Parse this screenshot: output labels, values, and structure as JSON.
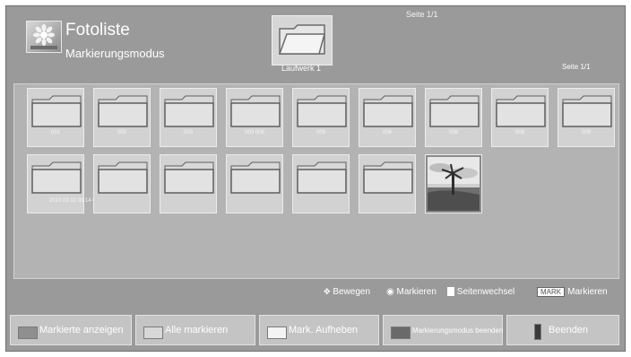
{
  "header": {
    "title": "Fotoliste",
    "subtitle": "Markierungsmodus",
    "page_indicator_top": "Seite 1/1",
    "drive_label": "Laufwerk 1",
    "page_indicator_right": "Seite 1/1"
  },
  "tiles": [
    {
      "type": "folder",
      "label": "001"
    },
    {
      "type": "folder",
      "label": "002"
    },
    {
      "type": "folder",
      "label": "003"
    },
    {
      "type": "folder",
      "label": "003 006"
    },
    {
      "type": "folder",
      "label": "005"
    },
    {
      "type": "folder",
      "label": "006"
    },
    {
      "type": "folder",
      "label": "008"
    },
    {
      "type": "folder",
      "label": "008"
    },
    {
      "type": "folder",
      "label": "009"
    },
    {
      "type": "folder",
      "label": "2010 03 02 03 14 01 1"
    },
    {
      "type": "folder",
      "label": ""
    },
    {
      "type": "folder",
      "label": ""
    },
    {
      "type": "folder",
      "label": ""
    },
    {
      "type": "folder",
      "label": ""
    },
    {
      "type": "folder",
      "label": ""
    },
    {
      "type": "photo",
      "label": ""
    }
  ],
  "status": {
    "move": "Bewegen",
    "mark": "Markieren",
    "page_change": "Seitenwechsel",
    "mark_key": "MARK",
    "mark_key_label": "Markieren"
  },
  "buttons": [
    {
      "label": "Markierte anzeigen",
      "color": "#8f8f8f"
    },
    {
      "label": "Alle markieren",
      "color": "#d8d8d8"
    },
    {
      "label": "Mark. Aufheben",
      "color": "#f4f4f4"
    },
    {
      "label": "Markierungsmodus beenden",
      "color": "#6a6a6a"
    },
    {
      "label": "Beenden",
      "color": "#3a3a3a"
    }
  ]
}
